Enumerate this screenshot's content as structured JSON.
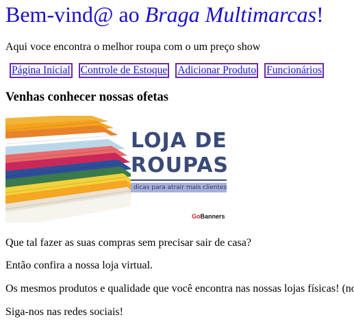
{
  "header": {
    "title_prefix": "Bem-vind@ ao ",
    "title_brand": "Braga Multimarcas",
    "title_suffix": "!"
  },
  "intro": "Aqui voce encontra o melhor roupa com o um preço show",
  "nav": {
    "items": [
      {
        "label": "Página Inicial"
      },
      {
        "label": "Controle de Estoque"
      },
      {
        "label": "Adicionar Produto"
      },
      {
        "label": "Funcionários"
      }
    ]
  },
  "section_heading": "Venhas conhecer nossas ofetas",
  "banner": {
    "title_line1": "LOJA DE",
    "title_line2": "ROUPAS",
    "tagline": "dicas para atrair mais clientes",
    "brand_go": "Go",
    "brand_rest": "Banners"
  },
  "paragraphs": [
    "Que tal fazer as suas compras sem precisar sair de casa?",
    "Então confira a nossa loja virtual.",
    "Os mesmos produtos e qualidade que você encontra nas nossas lojas físicas! (no",
    "Siga-nos nas redes sociais!"
  ],
  "colors": {
    "link": "#1a10c8",
    "link_border": "#6b2aa8",
    "banner_text": "#3a4a78",
    "banner_tag_bg": "#a6b0da"
  }
}
